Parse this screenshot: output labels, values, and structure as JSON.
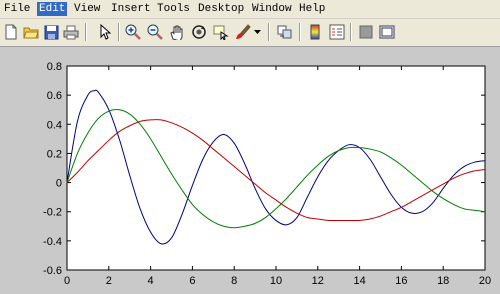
{
  "menu": {
    "items": [
      {
        "label": "File"
      },
      {
        "label": "Edit",
        "active": true
      },
      {
        "label": "View"
      },
      {
        "label": "Insert"
      },
      {
        "label": "Tools"
      },
      {
        "label": "Desktop"
      },
      {
        "label": "Window"
      },
      {
        "label": "Help"
      }
    ]
  },
  "toolbar": {
    "icons": [
      "new-figure-icon",
      "open-file-icon",
      "save-icon",
      "print-icon",
      "edit-plot-arrow-icon",
      "zoom-in-icon",
      "zoom-out-icon",
      "pan-hand-icon",
      "rotate-3d-icon",
      "data-cursor-icon",
      "brush-icon",
      "brush-dropdown-icon",
      "link-plot-icon",
      "insert-colorbar-icon",
      "insert-legend-icon",
      "hide-plot-tools-icon",
      "show-plot-tools-icon"
    ]
  },
  "chart_data": {
    "type": "line",
    "xlim": [
      0,
      20
    ],
    "ylim": [
      -0.6,
      0.8
    ],
    "x_ticks": [
      "0",
      "2",
      "4",
      "6",
      "8",
      "10",
      "12",
      "14",
      "16",
      "18",
      "20"
    ],
    "y_ticks": [
      "0.8",
      "0.6",
      "0.4",
      "0.2",
      "0",
      "-0.2",
      "-0.4",
      "-0.6"
    ],
    "grid": false,
    "series": [
      {
        "color": "#00007f",
        "x": [
          0,
          0.5,
          1,
          1.3,
          1.5,
          2,
          2.5,
          3,
          3.5,
          4,
          4.5,
          5,
          5.5,
          6,
          6.5,
          7,
          7.5,
          8,
          8.5,
          9,
          9.5,
          10,
          10.5,
          11,
          11.5,
          12,
          12.5,
          13,
          13.5,
          14,
          14.5,
          15,
          15.5,
          16,
          16.5,
          17,
          17.5,
          18,
          18.5,
          19,
          19.5,
          20
        ],
        "y": [
          0,
          0.42,
          0.6,
          0.63,
          0.62,
          0.5,
          0.3,
          0.05,
          -0.18,
          -0.34,
          -0.42,
          -0.38,
          -0.22,
          -0.02,
          0.16,
          0.28,
          0.33,
          0.27,
          0.13,
          -0.04,
          -0.18,
          -0.26,
          -0.29,
          -0.24,
          -0.1,
          0.04,
          0.15,
          0.22,
          0.26,
          0.24,
          0.16,
          0.04,
          -0.08,
          -0.17,
          -0.21,
          -0.2,
          -0.14,
          -0.04,
          0.05,
          0.11,
          0.14,
          0.15
        ]
      },
      {
        "color": "#007f00",
        "x": [
          0,
          0.5,
          1,
          1.5,
          2,
          2.5,
          3,
          3.5,
          4,
          4.5,
          5,
          5.5,
          6,
          6.5,
          7,
          7.5,
          8,
          8.5,
          9,
          9.5,
          10,
          10.5,
          11,
          11.5,
          12,
          12.5,
          13,
          13.5,
          14,
          14.5,
          15,
          15.5,
          16,
          16.5,
          17,
          17.5,
          18,
          18.5,
          19,
          19.5,
          20
        ],
        "y": [
          0,
          0.2,
          0.34,
          0.44,
          0.49,
          0.5,
          0.47,
          0.4,
          0.3,
          0.18,
          0.06,
          -0.05,
          -0.15,
          -0.22,
          -0.27,
          -0.3,
          -0.31,
          -0.3,
          -0.28,
          -0.24,
          -0.18,
          -0.11,
          -0.03,
          0.05,
          0.12,
          0.18,
          0.22,
          0.24,
          0.24,
          0.23,
          0.21,
          0.17,
          0.12,
          0.06,
          0.0,
          -0.06,
          -0.11,
          -0.15,
          -0.18,
          -0.19,
          -0.2
        ]
      },
      {
        "color": "#bf0000",
        "x": [
          0,
          0.5,
          1,
          1.5,
          2,
          2.5,
          3,
          3.5,
          4,
          4.5,
          5,
          5.5,
          6,
          6.5,
          7,
          7.5,
          8,
          8.5,
          9,
          9.5,
          10,
          10.5,
          11,
          11.5,
          12,
          12.5,
          13,
          13.5,
          14,
          14.5,
          15,
          15.5,
          16,
          16.5,
          17,
          17.5,
          18,
          18.5,
          19,
          19.5,
          20
        ],
        "y": [
          0,
          0.07,
          0.15,
          0.22,
          0.29,
          0.35,
          0.39,
          0.42,
          0.43,
          0.43,
          0.41,
          0.38,
          0.34,
          0.29,
          0.23,
          0.17,
          0.11,
          0.05,
          -0.01,
          -0.07,
          -0.12,
          -0.17,
          -0.21,
          -0.24,
          -0.25,
          -0.26,
          -0.26,
          -0.26,
          -0.26,
          -0.25,
          -0.23,
          -0.2,
          -0.17,
          -0.13,
          -0.09,
          -0.05,
          -0.01,
          0.03,
          0.06,
          0.08,
          0.09
        ]
      }
    ]
  }
}
